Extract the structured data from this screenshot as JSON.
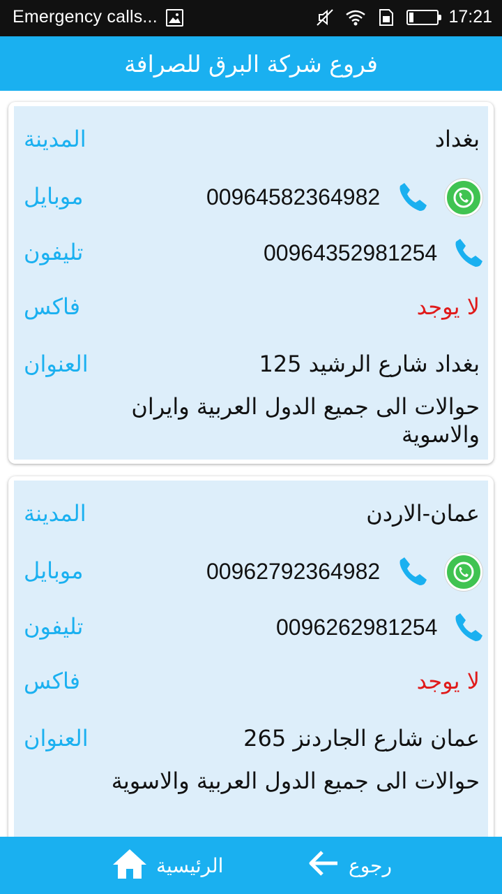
{
  "status_bar": {
    "notification_text": "Emergency calls...",
    "time": "17:21",
    "battery_level": 0.15,
    "icons": [
      "gallery-icon",
      "mute-icon",
      "wifi-icon",
      "sim-icon",
      "battery-icon"
    ]
  },
  "header": {
    "title": "فروع شركة البرق للصرافة"
  },
  "labels": {
    "city": "المدينة",
    "mobile": "موبايل",
    "phone": "تليفون",
    "fax": "فاكس",
    "address": "العنوان"
  },
  "branches": [
    {
      "city": "بغداد",
      "mobile": "00964582364982",
      "phone": "00964352981254",
      "fax": "لا يوجد",
      "address": "بغداد شارع الرشيد 125",
      "notes": "حوالات الى جميع الدول العربية وايران والاسوية"
    },
    {
      "city": "عمان-الاردن",
      "mobile": "00962792364982",
      "phone": "0096262981254",
      "fax": "لا يوجد",
      "address": "عمان شارع الجاردنز 265",
      "notes": "حوالات الى جميع الدول العربية والاسوية"
    }
  ],
  "bottom_nav": {
    "back_label": "رجوع",
    "home_label": "الرئيسية"
  },
  "colors": {
    "accent": "#1ab0f0",
    "card_background": "#ddeefa",
    "fax_value": "#e01b1b",
    "whatsapp": "#40c351"
  }
}
